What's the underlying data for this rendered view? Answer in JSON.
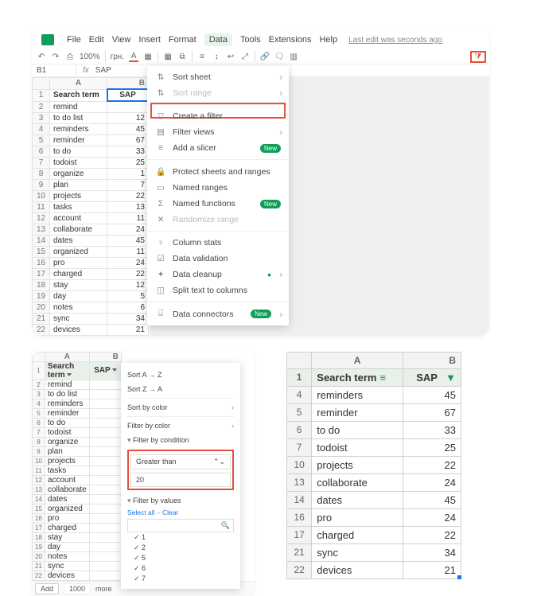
{
  "menubar": {
    "items": [
      "File",
      "Edit",
      "View",
      "Insert",
      "Format",
      "Data",
      "Tools",
      "Extensions",
      "Help"
    ],
    "active_index": 5,
    "last_edit": "Last edit was seconds ago"
  },
  "toolbar": {
    "zoom": "100%",
    "currency": "грн.",
    "filter_glyph": "⧩"
  },
  "namebox": {
    "ref": "B1",
    "fx": "fx",
    "formula": "SAP"
  },
  "sheet1": {
    "cols": [
      "A",
      "B"
    ],
    "header": {
      "A": "Search term",
      "B": "SAP"
    },
    "rows": [
      {
        "n": 2,
        "a": "remind",
        "b": ""
      },
      {
        "n": 3,
        "a": "to do list",
        "b": "12"
      },
      {
        "n": 4,
        "a": "reminders",
        "b": "45"
      },
      {
        "n": 5,
        "a": "reminder",
        "b": "67"
      },
      {
        "n": 6,
        "a": "to do",
        "b": "33"
      },
      {
        "n": 7,
        "a": "todoist",
        "b": "25"
      },
      {
        "n": 8,
        "a": "organize",
        "b": "1"
      },
      {
        "n": 9,
        "a": "plan",
        "b": "7"
      },
      {
        "n": 10,
        "a": "projects",
        "b": "22"
      },
      {
        "n": 11,
        "a": "tasks",
        "b": "13"
      },
      {
        "n": 12,
        "a": "account",
        "b": "11"
      },
      {
        "n": 13,
        "a": "collaborate",
        "b": "24"
      },
      {
        "n": 14,
        "a": "dates",
        "b": "45"
      },
      {
        "n": 15,
        "a": "organized",
        "b": "11"
      },
      {
        "n": 16,
        "a": "pro",
        "b": "24"
      },
      {
        "n": 17,
        "a": "charged",
        "b": "22"
      },
      {
        "n": 18,
        "a": "stay",
        "b": "12"
      },
      {
        "n": 19,
        "a": "day",
        "b": "5"
      },
      {
        "n": 20,
        "a": "notes",
        "b": "6"
      },
      {
        "n": 21,
        "a": "sync",
        "b": "34"
      },
      {
        "n": 22,
        "a": "devices",
        "b": "21"
      }
    ]
  },
  "data_menu": {
    "sort_sheet": "Sort sheet",
    "sort_range": "Sort range",
    "create_filter": "Create a filter",
    "filter_views": "Filter views",
    "add_slicer": "Add a slicer",
    "protect": "Protect sheets and ranges",
    "named_ranges": "Named ranges",
    "named_functions": "Named functions",
    "randomize": "Randomize range",
    "column_stats": "Column stats",
    "data_validation": "Data validation",
    "data_cleanup": "Data cleanup",
    "split_text": "Split text to columns",
    "data_connectors": "Data connectors",
    "new_badge": "New"
  },
  "sheet2": {
    "cols": [
      "A",
      "B"
    ],
    "header": {
      "A": "Search term",
      "B": "SAP"
    },
    "rows": [
      {
        "n": 2,
        "a": "remind"
      },
      {
        "n": 3,
        "a": "to do list"
      },
      {
        "n": 4,
        "a": "reminders"
      },
      {
        "n": 5,
        "a": "reminder"
      },
      {
        "n": 6,
        "a": "to do"
      },
      {
        "n": 7,
        "a": "todoist"
      },
      {
        "n": 8,
        "a": "organize"
      },
      {
        "n": 9,
        "a": "plan"
      },
      {
        "n": 10,
        "a": "projects"
      },
      {
        "n": 11,
        "a": "tasks"
      },
      {
        "n": 12,
        "a": "account"
      },
      {
        "n": 13,
        "a": "collaborate"
      },
      {
        "n": 14,
        "a": "dates"
      },
      {
        "n": 15,
        "a": "organized"
      },
      {
        "n": 16,
        "a": "pro"
      },
      {
        "n": 17,
        "a": "charged"
      },
      {
        "n": 18,
        "a": "stay"
      },
      {
        "n": 19,
        "a": "day"
      },
      {
        "n": 20,
        "a": "notes"
      },
      {
        "n": 21,
        "a": "sync"
      },
      {
        "n": 22,
        "a": "devices"
      }
    ],
    "footer": {
      "add": "Add",
      "count": "1000",
      "more": "more"
    }
  },
  "filter_panel": {
    "sort_az": "Sort A → Z",
    "sort_za": "Sort Z → A",
    "sort_color": "Sort by color",
    "filter_color": "Filter by color",
    "filter_condition": "Filter by condition",
    "condition": "Greater than",
    "value": "20",
    "filter_values": "Filter by values",
    "select_all": "Select all",
    "clear": "Clear",
    "vals": [
      "1",
      "2",
      "5",
      "6",
      "7"
    ]
  },
  "sheet3": {
    "cols": [
      "A",
      "B"
    ],
    "header": {
      "A": "Search term",
      "B": "SAP"
    },
    "rows": [
      {
        "n": 4,
        "a": "reminders",
        "b": "45"
      },
      {
        "n": 5,
        "a": "reminder",
        "b": "67"
      },
      {
        "n": 6,
        "a": "to do",
        "b": "33"
      },
      {
        "n": 7,
        "a": "todoist",
        "b": "25"
      },
      {
        "n": 10,
        "a": "projects",
        "b": "22"
      },
      {
        "n": 13,
        "a": "collaborate",
        "b": "24"
      },
      {
        "n": 14,
        "a": "dates",
        "b": "45"
      },
      {
        "n": 16,
        "a": "pro",
        "b": "24"
      },
      {
        "n": 17,
        "a": "charged",
        "b": "22"
      },
      {
        "n": 21,
        "a": "sync",
        "b": "34"
      },
      {
        "n": 22,
        "a": "devices",
        "b": "21"
      }
    ]
  }
}
